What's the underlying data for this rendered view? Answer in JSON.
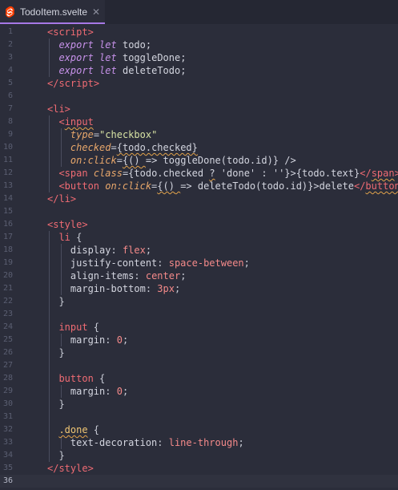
{
  "tab": {
    "title": "TodoItem.svelte",
    "icon": "svelte-icon",
    "close_icon": "✕",
    "accent_color": "#a678e6"
  },
  "colors": {
    "background": "#2b2d3a",
    "tag": "#ef6b73",
    "attribute": "#e8a76b",
    "keyword": "#c792ea",
    "string": "#d7e2a4",
    "number": "#f58a8a"
  },
  "editor": {
    "active_line": 36,
    "lines": [
      {
        "n": "1"
      },
      {
        "n": "2"
      },
      {
        "n": "3"
      },
      {
        "n": "4"
      },
      {
        "n": "5"
      },
      {
        "n": "6"
      },
      {
        "n": "7"
      },
      {
        "n": "8"
      },
      {
        "n": "9"
      },
      {
        "n": "10"
      },
      {
        "n": "11"
      },
      {
        "n": "12"
      },
      {
        "n": "13"
      },
      {
        "n": "14"
      },
      {
        "n": "15"
      },
      {
        "n": "16"
      },
      {
        "n": "17"
      },
      {
        "n": "18"
      },
      {
        "n": "19"
      },
      {
        "n": "20"
      },
      {
        "n": "21"
      },
      {
        "n": "22"
      },
      {
        "n": "23"
      },
      {
        "n": "24"
      },
      {
        "n": "25"
      },
      {
        "n": "26"
      },
      {
        "n": "27"
      },
      {
        "n": "28"
      },
      {
        "n": "29"
      },
      {
        "n": "30"
      },
      {
        "n": "31"
      },
      {
        "n": "32"
      },
      {
        "n": "33"
      },
      {
        "n": "34"
      },
      {
        "n": "35"
      },
      {
        "n": "36"
      }
    ],
    "tokens": {
      "l1": [
        "<script>"
      ],
      "l2": [
        "export",
        "let",
        "todo;"
      ],
      "l3": [
        "export",
        "let",
        "toggleDone;"
      ],
      "l4": [
        "export",
        "let",
        "deleteTodo;"
      ],
      "l5": [
        "</",
        "script",
        ">"
      ],
      "l7": [
        "<li>"
      ],
      "l8": [
        "<",
        "input"
      ],
      "l9": [
        "type",
        "=",
        "\"checkbox\""
      ],
      "l10": [
        "checked",
        "=",
        "{todo.checked}"
      ],
      "l11": [
        "on:click",
        "=",
        "{",
        "()",
        " ",
        "=>",
        " toggleDone(todo.id)}",
        " />"
      ],
      "l12": [
        "<span ",
        "class",
        "=",
        "{todo.checked ",
        "?",
        " ",
        "'done'",
        " : ",
        "''",
        "}>",
        "{todo.text}",
        "</",
        "span",
        ">"
      ],
      "l13": [
        "<button ",
        "on:click",
        "=",
        "{",
        "()",
        " ",
        "=>",
        " deleteTodo(todo.id)}>",
        "delete",
        "</",
        "button",
        ">"
      ],
      "l14": [
        "</",
        "li",
        ">"
      ],
      "l16": [
        "<style>"
      ],
      "l17": [
        "li",
        " {"
      ],
      "l18": [
        "display",
        ": ",
        "flex",
        ";"
      ],
      "l19": [
        "justify-content",
        ": ",
        "space-between",
        ";"
      ],
      "l20": [
        "align-items",
        ": ",
        "center",
        ";"
      ],
      "l21": [
        "margin-bottom",
        ": ",
        "3px",
        ";"
      ],
      "l22": [
        "}"
      ],
      "l24": [
        "input",
        " {"
      ],
      "l25": [
        "margin",
        ": ",
        "0",
        ";"
      ],
      "l26": [
        "}"
      ],
      "l28": [
        "button",
        " {"
      ],
      "l29": [
        "margin",
        ": ",
        "0",
        ";"
      ],
      "l30": [
        "}"
      ],
      "l32": [
        ".done",
        " {"
      ],
      "l33": [
        "text-decoration",
        ": ",
        "line-through",
        ";"
      ],
      "l34": [
        "}"
      ],
      "l35": [
        "</",
        "style",
        ">"
      ]
    }
  }
}
